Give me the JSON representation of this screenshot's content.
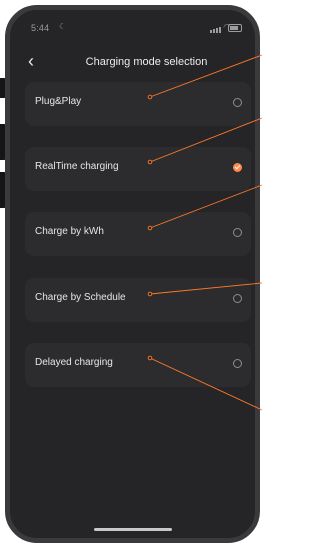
{
  "status_bar": {
    "time": "5:44",
    "icons": [
      "moon-icon",
      "signal-icon",
      "wifi-icon",
      "battery-icon"
    ]
  },
  "header": {
    "back_icon": "chevron-left-icon",
    "title": "Charging mode selection"
  },
  "modes": [
    {
      "label": "Plug&Play",
      "selected": false
    },
    {
      "label": "RealTime charging",
      "selected": true
    },
    {
      "label": "Charge by kWh",
      "selected": false
    },
    {
      "label": "Charge by Schedule",
      "selected": false
    },
    {
      "label": "Delayed charging",
      "selected": false
    }
  ],
  "colors": {
    "background": "#252527",
    "card": "#2c2c2f",
    "accent": "#ff8a4c",
    "callout_line": "#ff7a2a"
  }
}
